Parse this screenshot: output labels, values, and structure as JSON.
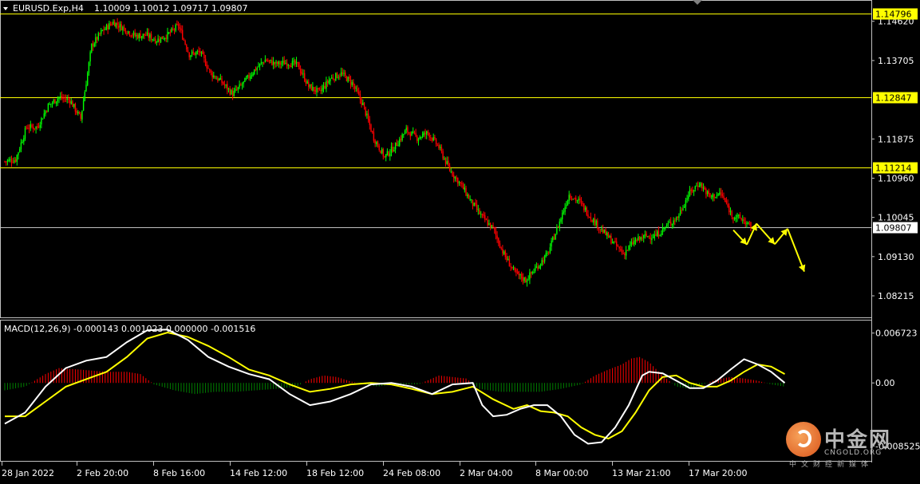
{
  "header": {
    "symbol": "EURUSD.Exp,H4",
    "ohlc": "1.10009 1.10012 1.09717 1.09807"
  },
  "macd_header": "MACD(12,26,9) -0.000143 0.001023 0.000000 -0.001516",
  "watermark": {
    "cn": "中金网",
    "en": "CNGOLD.ORG",
    "sub": "中文财经新媒体"
  },
  "colors": {
    "bull": "#00ff00",
    "bear": "#ff0000",
    "level": "#ffff00",
    "current": "#c0c0c0",
    "macd_line": "#ffffff",
    "signal_line": "#ffff00",
    "hist_pos": "#ff0000",
    "hist_neg": "#008000"
  },
  "chart_data": [
    {
      "type": "candlestick",
      "ylim": [
        1.0775,
        1.1508
      ],
      "y_tick_labels": [
        "1.14620",
        "1.13705",
        "1.11875",
        "1.10960",
        "1.10045",
        "1.09130",
        "1.08215"
      ],
      "y_ticks": [
        1.1462,
        1.13705,
        1.11875,
        1.1096,
        1.10045,
        1.0913,
        1.08215
      ],
      "x_tick_labels": [
        "28 Jan 2022",
        "2 Feb 20:00",
        "8 Feb 16:00",
        "14 Feb 12:00",
        "18 Feb 12:00",
        "24 Feb 08:00",
        "2 Mar 04:00",
        "8 Mar 00:00",
        "13 Mar 21:00",
        "17 Mar 20:00"
      ],
      "horizontal_levels": [
        {
          "label": "1.14796",
          "value": 1.14796
        },
        {
          "label": "1.12847",
          "value": 1.12847
        },
        {
          "label": "1.11214",
          "value": 1.11214
        }
      ],
      "current_price": {
        "label": "1.09807",
        "value": 1.09807
      },
      "path": [
        [
          0,
          1.1135
        ],
        [
          8,
          1.114
        ],
        [
          16,
          1.1215
        ],
        [
          24,
          1.1215
        ],
        [
          32,
          1.1265
        ],
        [
          40,
          1.1285
        ],
        [
          48,
          1.1278
        ],
        [
          56,
          1.1235
        ],
        [
          64,
          1.1405
        ],
        [
          72,
          1.144
        ],
        [
          80,
          1.146
        ],
        [
          88,
          1.1445
        ],
        [
          96,
          1.1428
        ],
        [
          104,
          1.143
        ],
        [
          112,
          1.1418
        ],
        [
          120,
          1.143
        ],
        [
          128,
          1.1452
        ],
        [
          136,
          1.1385
        ],
        [
          144,
          1.139
        ],
        [
          152,
          1.134
        ],
        [
          160,
          1.132
        ],
        [
          168,
          1.1292
        ],
        [
          176,
          1.1318
        ],
        [
          184,
          1.1348
        ],
        [
          192,
          1.1372
        ],
        [
          200,
          1.1362
        ],
        [
          208,
          1.1366
        ],
        [
          216,
          1.136
        ],
        [
          224,
          1.131
        ],
        [
          232,
          1.1296
        ],
        [
          240,
          1.1328
        ],
        [
          248,
          1.134
        ],
        [
          256,
          1.1318
        ],
        [
          264,
          1.1268
        ],
        [
          272,
          1.119
        ],
        [
          280,
          1.1145
        ],
        [
          288,
          1.1172
        ],
        [
          296,
          1.1208
        ],
        [
          304,
          1.119
        ],
        [
          312,
          1.1202
        ],
        [
          320,
          1.1168
        ],
        [
          328,
          1.1115
        ],
        [
          336,
          1.1082
        ],
        [
          344,
          1.104
        ],
        [
          352,
          1.1005
        ],
        [
          360,
          1.0978
        ],
        [
          368,
          1.0918
        ],
        [
          376,
          1.0875
        ],
        [
          384,
          1.0858
        ],
        [
          392,
          1.0888
        ],
        [
          400,
          1.0918
        ],
        [
          408,
          1.0985
        ],
        [
          416,
          1.1058
        ],
        [
          424,
          1.104
        ],
        [
          432,
          1.1005
        ],
        [
          440,
          1.0975
        ],
        [
          448,
          1.0948
        ],
        [
          456,
          1.092
        ],
        [
          464,
          1.0948
        ],
        [
          472,
          1.096
        ],
        [
          480,
          1.0962
        ],
        [
          488,
          1.0985
        ],
        [
          496,
          1.1005
        ],
        [
          504,
          1.1058
        ],
        [
          512,
          1.1085
        ],
        [
          520,
          1.1052
        ],
        [
          528,
          1.106
        ],
        [
          536,
          1.101
        ],
        [
          544,
          1.0999
        ],
        [
          550,
          1.0981
        ]
      ],
      "yellow_forecast_path": [
        [
          1.0975,
          1.0941
        ],
        [
          1.0941,
          1.099
        ],
        [
          1.099,
          1.0942
        ],
        [
          1.0942,
          1.0978
        ],
        [
          1.0978,
          1.0878
        ]
      ]
    },
    {
      "type": "macd",
      "title": "MACD(12,26,9)",
      "ylim": [
        -0.0103,
        0.0082
      ],
      "y_tick_labels": [
        "0.006723",
        "0.00",
        "-0.008525"
      ],
      "y_ticks": [
        0.006723,
        0.0,
        -0.008525
      ],
      "macd": [
        [
          0,
          -0.0055
        ],
        [
          15,
          -0.004
        ],
        [
          30,
          -0.0005
        ],
        [
          45,
          0.002
        ],
        [
          60,
          0.003
        ],
        [
          75,
          0.0035
        ],
        [
          90,
          0.0055
        ],
        [
          105,
          0.0071
        ],
        [
          120,
          0.0072
        ],
        [
          135,
          0.0058
        ],
        [
          150,
          0.0035
        ],
        [
          165,
          0.0022
        ],
        [
          180,
          0.0012
        ],
        [
          195,
          0.0005
        ],
        [
          210,
          -0.0015
        ],
        [
          225,
          -0.003
        ],
        [
          240,
          -0.0025
        ],
        [
          255,
          -0.0015
        ],
        [
          270,
          -0.0002
        ],
        [
          285,
          0.0
        ],
        [
          300,
          -0.0005
        ],
        [
          315,
          -0.0015
        ],
        [
          330,
          -0.0002
        ],
        [
          345,
          0.0
        ],
        [
          352,
          -0.003
        ],
        [
          360,
          -0.0045
        ],
        [
          370,
          -0.0043
        ],
        [
          380,
          -0.0035
        ],
        [
          390,
          -0.003
        ],
        [
          400,
          -0.003
        ],
        [
          410,
          -0.0045
        ],
        [
          420,
          -0.007
        ],
        [
          430,
          -0.0082
        ],
        [
          440,
          -0.008
        ],
        [
          450,
          -0.006
        ],
        [
          460,
          -0.003
        ],
        [
          470,
          0.001
        ],
        [
          475,
          0.0015
        ],
        [
          485,
          0.0013
        ],
        [
          495,
          0.0003
        ],
        [
          505,
          -0.0007
        ],
        [
          515,
          -0.0007
        ],
        [
          525,
          0.0003
        ],
        [
          535,
          0.0018
        ],
        [
          545,
          0.0032
        ],
        [
          555,
          0.0025
        ],
        [
          565,
          0.0015
        ],
        [
          575,
          0.0
        ]
      ],
      "signal": [
        [
          0,
          -0.0045
        ],
        [
          15,
          -0.0045
        ],
        [
          30,
          -0.0025
        ],
        [
          45,
          -0.0005
        ],
        [
          60,
          0.0005
        ],
        [
          75,
          0.0015
        ],
        [
          90,
          0.0035
        ],
        [
          105,
          0.006
        ],
        [
          120,
          0.0068
        ],
        [
          135,
          0.0062
        ],
        [
          150,
          0.005
        ],
        [
          165,
          0.0035
        ],
        [
          180,
          0.0018
        ],
        [
          195,
          0.001
        ],
        [
          210,
          -0.0002
        ],
        [
          225,
          -0.0012
        ],
        [
          240,
          -0.0008
        ],
        [
          255,
          -0.0002
        ],
        [
          270,
          0.0
        ],
        [
          285,
          -0.0002
        ],
        [
          300,
          -0.0008
        ],
        [
          315,
          -0.0015
        ],
        [
          330,
          -0.0012
        ],
        [
          345,
          -0.0005
        ],
        [
          360,
          -0.0022
        ],
        [
          375,
          -0.0035
        ],
        [
          385,
          -0.003
        ],
        [
          395,
          -0.0038
        ],
        [
          405,
          -0.004
        ],
        [
          415,
          -0.0045
        ],
        [
          425,
          -0.006
        ],
        [
          435,
          -0.007
        ],
        [
          445,
          -0.0075
        ],
        [
          455,
          -0.0065
        ],
        [
          465,
          -0.004
        ],
        [
          475,
          -0.001
        ],
        [
          485,
          0.0008
        ],
        [
          495,
          0.001
        ],
        [
          505,
          0.0
        ],
        [
          515,
          -0.0005
        ],
        [
          525,
          -0.0005
        ],
        [
          535,
          0.0003
        ],
        [
          545,
          0.0015
        ],
        [
          555,
          0.0025
        ],
        [
          565,
          0.0022
        ],
        [
          575,
          0.0012
        ]
      ],
      "histogram": [
        [
          0,
          -0.001
        ],
        [
          15,
          -0.0005
        ],
        [
          30,
          0.0012
        ],
        [
          40,
          0.002
        ],
        [
          55,
          0.0018
        ],
        [
          75,
          0.0015
        ],
        [
          90,
          0.0015
        ],
        [
          100,
          0.0012
        ],
        [
          110,
          -0.0002
        ],
        [
          125,
          -0.001
        ],
        [
          140,
          -0.0015
        ],
        [
          155,
          -0.0012
        ],
        [
          170,
          -0.0012
        ],
        [
          185,
          -0.001
        ],
        [
          200,
          -0.0008
        ],
        [
          215,
          -0.0005
        ],
        [
          225,
          0.0005
        ],
        [
          235,
          0.001
        ],
        [
          245,
          0.0008
        ],
        [
          255,
          0.0002
        ],
        [
          265,
          -0.0002
        ],
        [
          275,
          -0.0005
        ],
        [
          285,
          -0.0002
        ],
        [
          295,
          -0.0002
        ],
        [
          305,
          -0.0002
        ],
        [
          320,
          0.001
        ],
        [
          330,
          0.0008
        ],
        [
          340,
          0.0006
        ],
        [
          350,
          -0.0008
        ],
        [
          365,
          -0.0012
        ],
        [
          380,
          -0.0012
        ],
        [
          395,
          -0.0012
        ],
        [
          410,
          -0.0008
        ],
        [
          425,
          -0.0002
        ],
        [
          435,
          0.001
        ],
        [
          445,
          0.0018
        ],
        [
          455,
          0.0025
        ],
        [
          462,
          0.0033
        ],
        [
          468,
          0.0035
        ],
        [
          475,
          0.0028
        ],
        [
          485,
          0.001
        ],
        [
          495,
          -0.0005
        ],
        [
          505,
          -0.0008
        ],
        [
          515,
          -0.0002
        ],
        [
          525,
          0.0005
        ],
        [
          535,
          0.0008
        ],
        [
          545,
          0.0006
        ],
        [
          555,
          0.0003
        ],
        [
          565,
          -0.0002
        ],
        [
          575,
          -0.0005
        ]
      ]
    }
  ]
}
